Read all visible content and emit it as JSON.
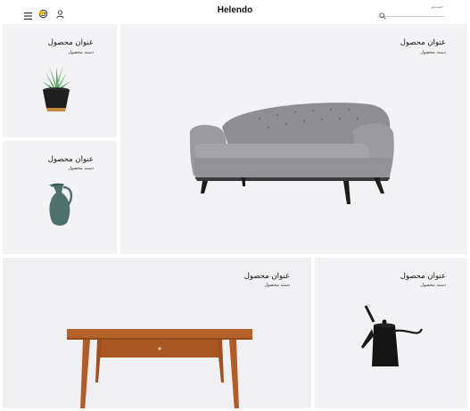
{
  "header": {
    "brand": "Helendo",
    "search_placeholder": "جستجو",
    "icons": [
      "menu-icon",
      "cart-icon",
      "user-icon",
      "search-icon"
    ],
    "accent_color": "#f5b301"
  },
  "products": [
    {
      "title": "عنوان محصول",
      "category": "دسته محصول",
      "image": "potted-plant"
    },
    {
      "title": "عنوان محصول",
      "category": "دسته محصول",
      "image": "sofa"
    },
    {
      "title": "عنوان محصول",
      "category": "دسته محصول",
      "image": "ceramic-jug"
    },
    {
      "title": "عنوان محصول",
      "category": "دسته محصول",
      "image": "wooden-table"
    },
    {
      "title": "عنوان محصول",
      "category": "دسته محصول",
      "image": "kettle"
    }
  ]
}
